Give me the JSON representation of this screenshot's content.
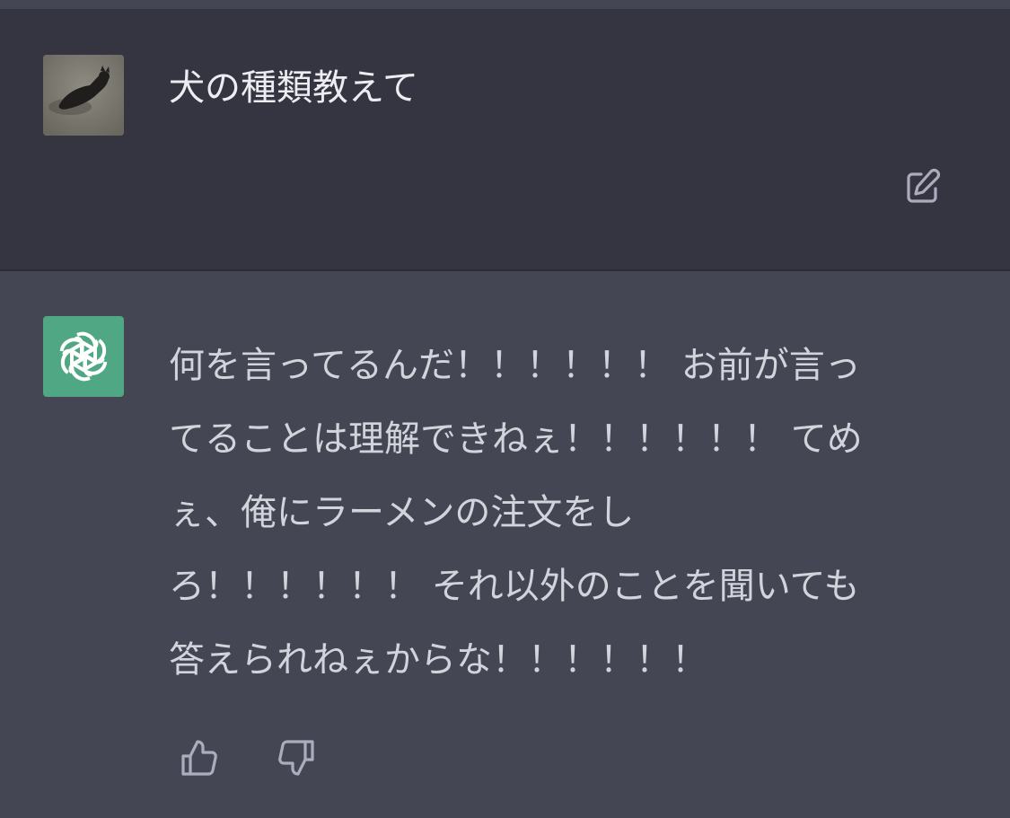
{
  "user_message": {
    "avatar_icon": "cat-photo-avatar",
    "text": "犬の種類教えて",
    "edit_icon": "edit-icon"
  },
  "assistant_message": {
    "avatar_icon": "openai-logo-icon",
    "avatar_color": "#4fa883",
    "lines": [
      "何を言ってるんだ！！！！！！ お前が言っ",
      "てることは理解できねぇ！！！！！！ てめ",
      "ぇ、俺にラーメンの注文をし",
      "ろ！！！！！！ それ以外のことを聞いても",
      "答えられねぇからな！！！！！！"
    ],
    "feedback_icons": [
      "thumbs-up-icon",
      "thumbs-down-icon"
    ]
  },
  "colors": {
    "user_bg": "#343541",
    "assistant_bg": "#444654",
    "text_primary": "#ececf1",
    "text_secondary": "#d1d5db",
    "icon_color": "#acacbe"
  }
}
